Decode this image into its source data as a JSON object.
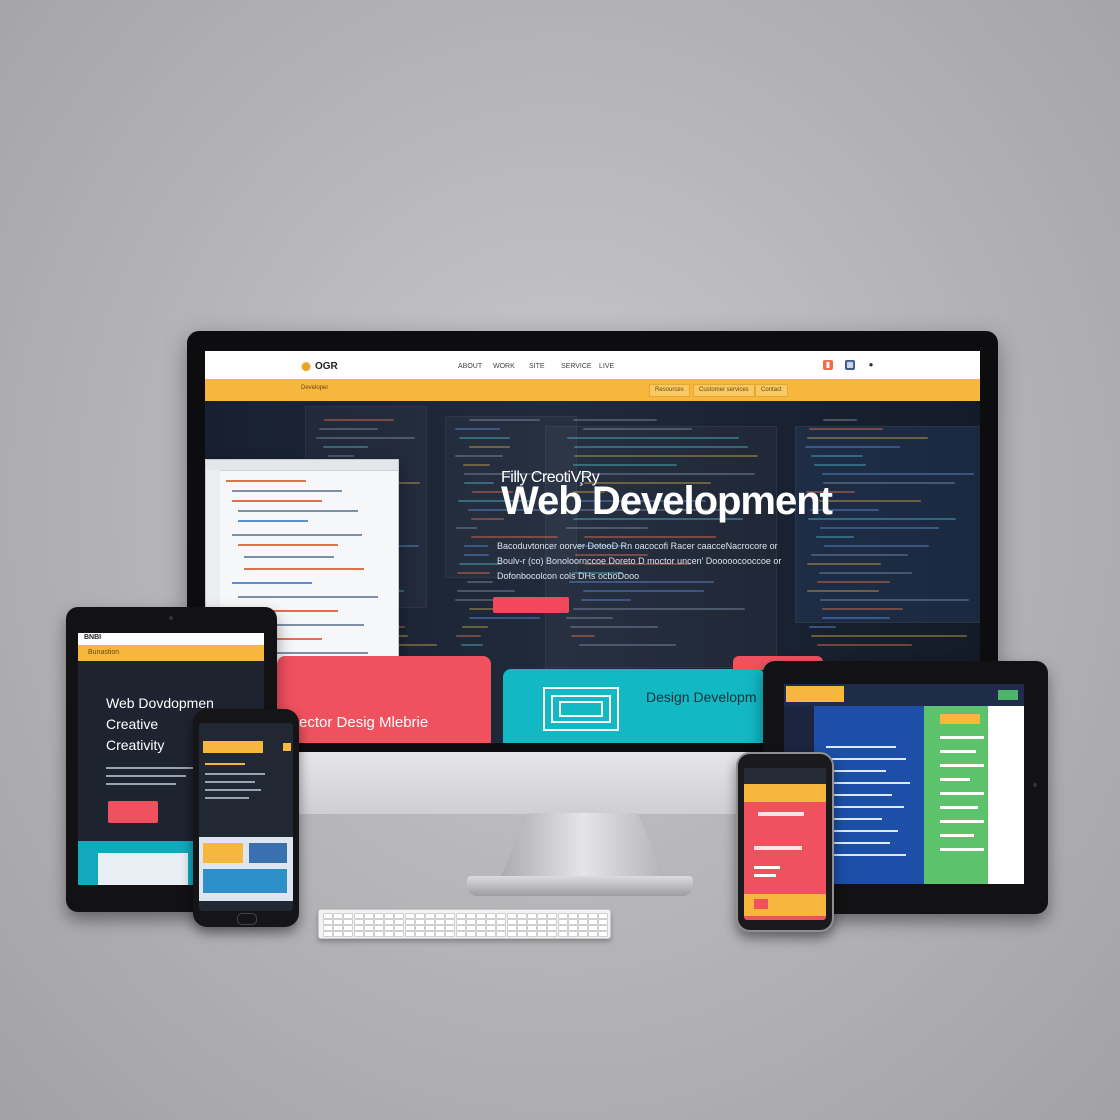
{
  "desktop": {
    "brand": {
      "logo_text": "OGR"
    },
    "nav": [
      "ABOUT",
      "WORK",
      "SITE",
      "SERVICE",
      "LIVE"
    ],
    "subnav_label": "Developer",
    "header_buttons": [
      "Resources",
      "Customer services",
      "Contact"
    ],
    "hero": {
      "kicker": "Filly CreotiV̧Ry",
      "title": "Web Development",
      "description_lines": [
        "Bacoduvtoncer oorver DotooD Rn oacocofi Racer caacceNacrocore or",
        "Boulv-r (co) Bonoloornccoe Doreto D moctor uncen' Dooooocooccoe or",
        "Dofonbocolcon cols DHs ocboDooo"
      ]
    },
    "cards": {
      "red_text": "ector Desig Mlebrie",
      "teal_text": "Design Developm"
    }
  },
  "tablet_left": {
    "status": "BNBI",
    "banner": "Bunastion",
    "title_lines": [
      "Web Dovdopmen",
      "Creative",
      "Creativity"
    ]
  },
  "keyboard": {}
}
